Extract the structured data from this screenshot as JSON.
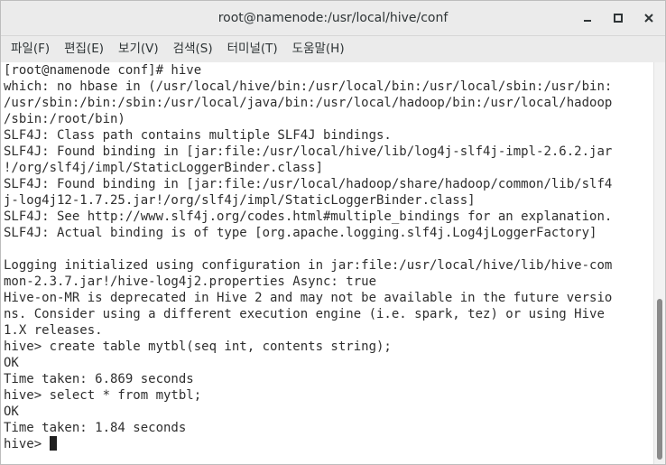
{
  "window": {
    "title": "root@namenode:/usr/local/hive/conf"
  },
  "menu": {
    "items": [
      "파일(F)",
      "편집(E)",
      "보기(V)",
      "검색(S)",
      "터미널(T)",
      "도움말(H)"
    ]
  },
  "terminal": {
    "lines": [
      "[root@namenode conf]# hive",
      "which: no hbase in (/usr/local/hive/bin:/usr/local/bin:/usr/local/sbin:/usr/bin:",
      "/usr/sbin:/bin:/sbin:/usr/local/java/bin:/usr/local/hadoop/bin:/usr/local/hadoop",
      "/sbin:/root/bin)",
      "SLF4J: Class path contains multiple SLF4J bindings.",
      "SLF4J: Found binding in [jar:file:/usr/local/hive/lib/log4j-slf4j-impl-2.6.2.jar",
      "!/org/slf4j/impl/StaticLoggerBinder.class]",
      "SLF4J: Found binding in [jar:file:/usr/local/hadoop/share/hadoop/common/lib/slf4",
      "j-log4j12-1.7.25.jar!/org/slf4j/impl/StaticLoggerBinder.class]",
      "SLF4J: See http://www.slf4j.org/codes.html#multiple_bindings for an explanation.",
      "SLF4J: Actual binding is of type [org.apache.logging.slf4j.Log4jLoggerFactory]",
      "",
      "Logging initialized using configuration in jar:file:/usr/local/hive/lib/hive-com",
      "mon-2.3.7.jar!/hive-log4j2.properties Async: true",
      "Hive-on-MR is deprecated in Hive 2 and may not be available in the future versio",
      "ns. Consider using a different execution engine (i.e. spark, tez) or using Hive",
      "1.X releases.",
      "hive> create table mytbl(seq int, contents string);",
      "OK",
      "Time taken: 6.869 seconds",
      "hive> select * from mytbl;",
      "OK",
      "Time taken: 1.84 seconds"
    ],
    "prompt": "hive> "
  }
}
